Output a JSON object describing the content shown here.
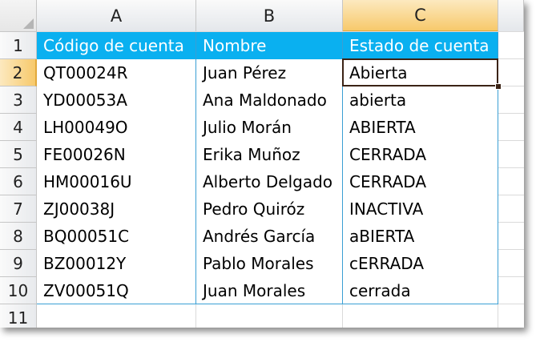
{
  "columns": [
    "A",
    "B",
    "C"
  ],
  "row_numbers": [
    "1",
    "2",
    "3",
    "4",
    "5",
    "6",
    "7",
    "8",
    "9",
    "10",
    "11"
  ],
  "selected": {
    "column": "C",
    "row": "2"
  },
  "header_row": [
    "Código de cuenta",
    "Nombre",
    "Estado de cuenta"
  ],
  "rows": [
    [
      "QT00024R",
      "Juan Pérez",
      "Abierta"
    ],
    [
      "YD00053A",
      "Ana Maldonado",
      "abierta"
    ],
    [
      "LH00049O",
      "Julio Morán",
      "ABIERTA"
    ],
    [
      "FE00026N",
      "Erika Muñoz",
      "CERRADA"
    ],
    [
      "HM00016U",
      "Alberto Delgado",
      "CERRADA"
    ],
    [
      "ZJ00038J",
      "Pedro Quiróz",
      "INACTIVA"
    ],
    [
      "BQ00051C",
      "Andrés García",
      "aBIERTA"
    ],
    [
      "BZ00012Y",
      "Pablo Morales",
      "cERRADA"
    ],
    [
      "ZV00051Q",
      "Juan Morales",
      "cerrada"
    ]
  ],
  "colors": {
    "header_fill": "#0ab0f0",
    "header_text": "#ffffff",
    "table_border": "#3a9fd4",
    "selection_highlight": "#f7c96b",
    "active_cell_border": "#3b2315"
  }
}
